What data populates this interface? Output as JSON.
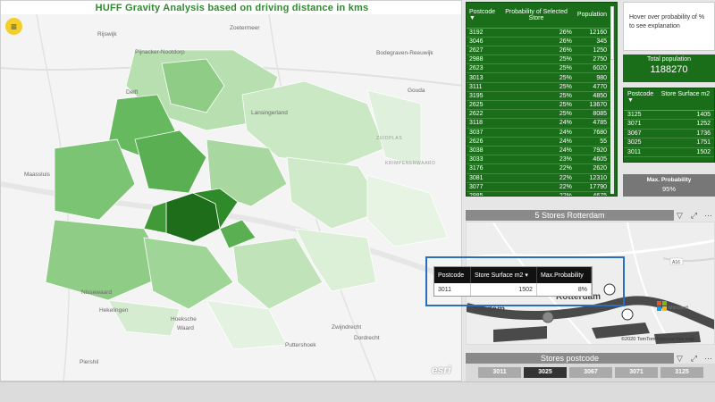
{
  "map_title": "HUFF Gravity Analysis based on driving distance in kms",
  "places": {
    "rijswijk": "Rijswijk",
    "zoetermeer": "Zoetermeer",
    "pijnacker": "Pijnacker-Nootdorp",
    "bodegraven": "Bodegraven-Reeuwijk",
    "delft": "Delft",
    "lansingerland": "Lansingerland",
    "gouda": "Gouda",
    "zuidplas": "ZUIDPLAS",
    "krimpenerwaard": "KRIMPENERWAARD",
    "maassluis": "Maassluis",
    "nissewaard": "Nissewaard",
    "hekelingen": "Hekelingen",
    "hoeksche": "Hoeksche",
    "waard": "Waard",
    "zwijndrecht": "Zwijndrecht",
    "dordrecht": "Dordrecht",
    "puttershoek": "Puttershoek",
    "piershil": "Piershil"
  },
  "esri": "esri",
  "probability_table": {
    "headers": {
      "postcode": "Postcode",
      "probability": "Probability of Selected Store",
      "population": "Population"
    },
    "rows": [
      [
        "3192",
        "26%",
        "12160"
      ],
      [
        "3046",
        "26%",
        "345"
      ],
      [
        "2627",
        "26%",
        "1250"
      ],
      [
        "2988",
        "25%",
        "2750"
      ],
      [
        "2623",
        "25%",
        "6020"
      ],
      [
        "3013",
        "25%",
        "980"
      ],
      [
        "3111",
        "25%",
        "4770"
      ],
      [
        "3195",
        "25%",
        "4850"
      ],
      [
        "2625",
        "25%",
        "13670"
      ],
      [
        "2622",
        "25%",
        "8085"
      ],
      [
        "3118",
        "24%",
        "4785"
      ],
      [
        "3037",
        "24%",
        "7680"
      ],
      [
        "2626",
        "24%",
        "55"
      ],
      [
        "3038",
        "24%",
        "7920"
      ],
      [
        "3033",
        "23%",
        "4605"
      ],
      [
        "3176",
        "22%",
        "2620"
      ],
      [
        "3081",
        "22%",
        "12310"
      ],
      [
        "3077",
        "22%",
        "17790"
      ],
      [
        "2985",
        "22%",
        "4675"
      ]
    ]
  },
  "hover_text": "Hover over probability of % to see explanation",
  "total_population": {
    "label": "Total population",
    "value": "1188270"
  },
  "surface_table": {
    "headers": {
      "postcode": "Postcode",
      "surface": "Store Surface m2"
    },
    "rows": [
      [
        "3125",
        "1405"
      ],
      [
        "3071",
        "1252"
      ],
      [
        "3067",
        "1736"
      ],
      [
        "3025",
        "1751"
      ],
      [
        "3011",
        "1502"
      ]
    ]
  },
  "max_probability": {
    "label": "Max. Probability",
    "value": "95%"
  },
  "stores_title": "5 Stores Rotterdam",
  "tooltip": {
    "headers": {
      "postcode": "Postcode",
      "surface": "Store Surface m2",
      "maxprob": "Max.Probability"
    },
    "row": [
      "3011",
      "1502",
      "8%"
    ]
  },
  "right_map_labels": {
    "rotterdam": "Rotterdam",
    "medam": "medam",
    "a16": "A16",
    "microsoft": "Microsoft"
  },
  "copyright": "©2020 TomTom Improve this map",
  "slicer": {
    "title": "Stores postcode",
    "chips": [
      "3011",
      "3025",
      "3067",
      "3071",
      "3125"
    ],
    "selected": "3025"
  },
  "colors": {
    "dark_green": "#1a6e1a",
    "accent_blue": "#2a6fbf",
    "menu_yellow": "#f3cf2c"
  }
}
